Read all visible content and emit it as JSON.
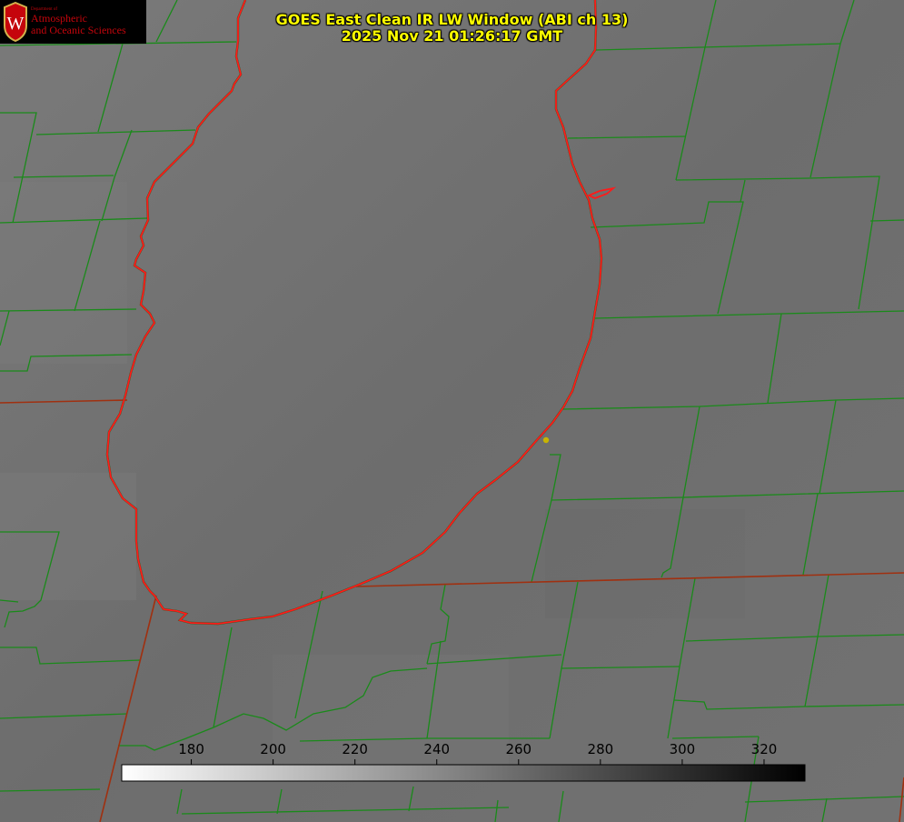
{
  "logo": {
    "department": "Department of",
    "line1": "Atmospheric",
    "line2": "and Oceanic Sciences",
    "crest_letter": "W"
  },
  "title": {
    "line1": "GOES East Clean IR LW Window (ABI ch 13)",
    "line2": "2025 Nov 21 01:26:17 GMT"
  },
  "colorbar": {
    "min": 163,
    "max": 330,
    "tick_labels": [
      "180",
      "200",
      "220",
      "240",
      "260",
      "280",
      "300",
      "320"
    ],
    "tick_values": [
      180,
      200,
      220,
      240,
      260,
      280,
      300,
      320
    ],
    "gradient": [
      "#ffffff",
      "#000000"
    ]
  },
  "colors": {
    "county_borders": "#1a8a1a",
    "lake_outline": "#ff2020",
    "state_border": "#a03010",
    "title_text": "#ffff00",
    "marker": "#c8b400",
    "background": "#727272"
  }
}
